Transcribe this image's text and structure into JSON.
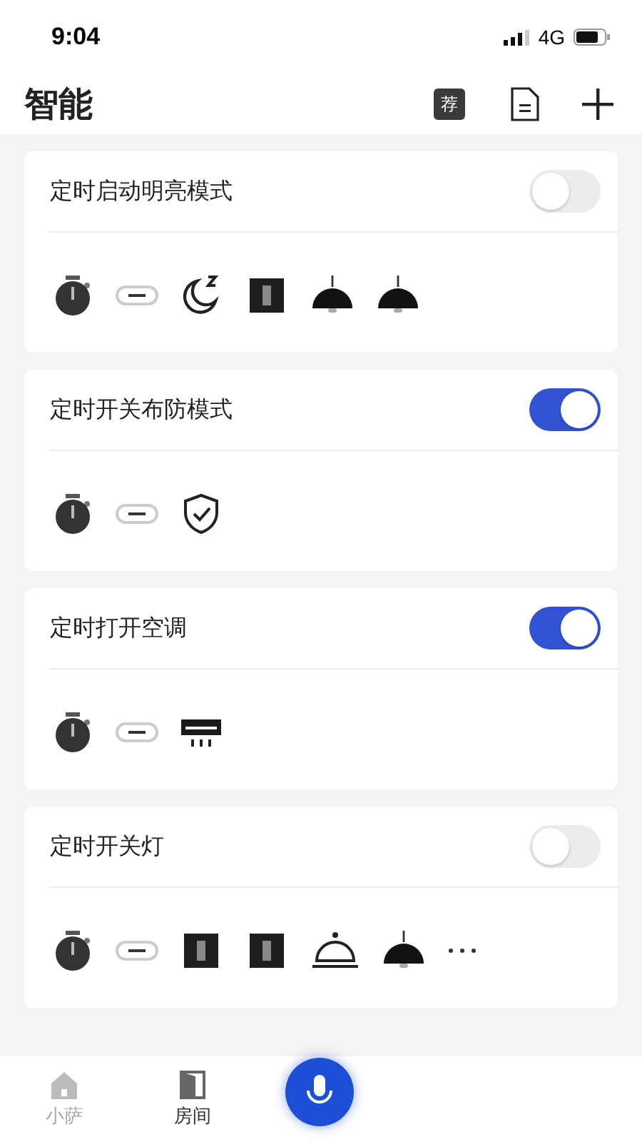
{
  "status_bar": {
    "time": "9:04",
    "network": "4G"
  },
  "header": {
    "title": "智能",
    "recommend_badge": "荐"
  },
  "scenes": [
    {
      "title": "定时启动明亮模式",
      "on": false,
      "devices": [
        {
          "kind": "timer"
        },
        {
          "kind": "link"
        },
        {
          "kind": "moon"
        },
        {
          "kind": "switch"
        },
        {
          "kind": "lamp"
        },
        {
          "kind": "lamp"
        }
      ]
    },
    {
      "title": "定时开关布防模式",
      "on": true,
      "devices": [
        {
          "kind": "timer"
        },
        {
          "kind": "link"
        },
        {
          "kind": "shield"
        }
      ]
    },
    {
      "title": "定时打开空调",
      "on": true,
      "devices": [
        {
          "kind": "timer"
        },
        {
          "kind": "link"
        },
        {
          "kind": "ac"
        }
      ]
    },
    {
      "title": "定时开关灯",
      "on": false,
      "devices": [
        {
          "kind": "timer"
        },
        {
          "kind": "link"
        },
        {
          "kind": "switch"
        },
        {
          "kind": "switch"
        },
        {
          "kind": "bell"
        },
        {
          "kind": "lamp"
        },
        {
          "kind": "more"
        }
      ]
    }
  ],
  "tabs": [
    {
      "label": "小萨",
      "selected": false,
      "kind": "home"
    },
    {
      "label": "房间",
      "selected": true,
      "kind": "door"
    }
  ]
}
